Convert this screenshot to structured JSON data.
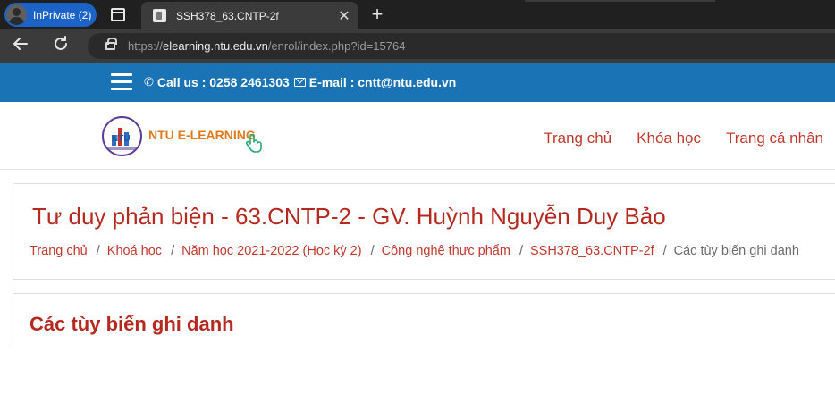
{
  "browser": {
    "inprivate_label": "InPrivate (2)",
    "tab_title": "SSH378_63.CNTP-2f",
    "tab_close": "✕",
    "new_tab": "+",
    "url_scheme": "https://",
    "url_host": "elearning.ntu.edu.vn",
    "url_path": "/enrol/index.php?id=15764"
  },
  "contact": {
    "call_text": "Call us : 0258 2461303",
    "email_text": "E-mail : cntt@ntu.edu.vn"
  },
  "logo": {
    "emblem_text": "NTU",
    "text": "NTU E-LEARNING"
  },
  "nav": {
    "items": [
      "Trang chủ",
      "Khóa học",
      "Trang cá nhân"
    ]
  },
  "page": {
    "course_title": "Tư duy phản biện - 63.CNTP-2 - GV. Huỳnh Nguyễn Duy Bảo",
    "breadcrumb": [
      "Trang chủ",
      "Khoá học",
      "Năm học 2021-2022 (Học kỳ 2)",
      "Công nghệ thực phẩm",
      "SSH378_63.CNTP-2f",
      "Các tùy biến ghi danh"
    ],
    "section_title": "Các tùy biến ghi danh"
  },
  "colors": {
    "brand_blue": "#1a73b5",
    "accent_red": "#c0392b",
    "logo_orange": "#e07a1f"
  }
}
